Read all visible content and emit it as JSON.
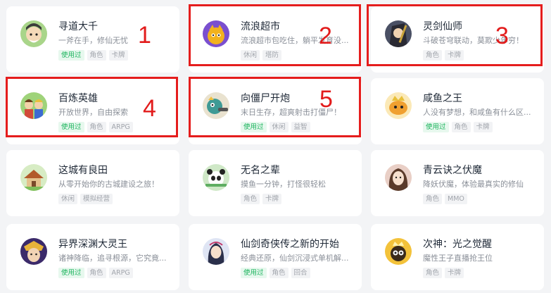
{
  "games": [
    {
      "title": "寻道大千",
      "desc": "一斧在手，修仙无忧",
      "tags": [
        "使用过",
        "角色",
        "卡牌"
      ],
      "avatar_icon": "cartoon-cultivator-icon",
      "avatar_color": "#8ac06a"
    },
    {
      "title": "流浪超市",
      "desc": "流浪超市包吃住，躺平发育没...",
      "tags": [
        "休闲",
        "塔防"
      ],
      "avatar_icon": "cartoon-kid-icon",
      "avatar_color": "#7a4fcf"
    },
    {
      "title": "灵剑仙师",
      "desc": "斗破苍穹联动，莫欺少年穷！",
      "tags": [
        "角色",
        "卡牌"
      ],
      "avatar_icon": "swordsman-icon",
      "avatar_color": "#3a3f4e"
    },
    {
      "title": "百炼英雄",
      "desc": "开放世界，自由探索",
      "tags": [
        "使用过",
        "角色",
        "ARPG"
      ],
      "avatar_icon": "hero-team-icon",
      "avatar_color": "#d24a3a"
    },
    {
      "title": "向僵尸开炮",
      "desc": "末日生存，超爽射击打僵尸！",
      "tags": [
        "使用过",
        "休闲",
        "益智"
      ],
      "avatar_icon": "zombie-gunner-icon",
      "avatar_color": "#2f8a86"
    },
    {
      "title": "咸鱼之王",
      "desc": "人没有梦想，和咸鱼有什么区...",
      "tags": [
        "使用过",
        "角色",
        "卡牌"
      ],
      "avatar_icon": "salted-fish-king-icon",
      "avatar_color": "#f0a030"
    },
    {
      "title": "这城有良田",
      "desc": "从零开始你的古城建设之旅！",
      "tags": [
        "休闲",
        "模拟经营"
      ],
      "avatar_icon": "village-building-icon",
      "avatar_color": "#c98a4a"
    },
    {
      "title": "无名之辈",
      "desc": "摸鱼一分钟，打怪很轻松",
      "tags": [
        "角色",
        "卡牌"
      ],
      "avatar_icon": "panda-icon",
      "avatar_color": "#5fae62"
    },
    {
      "title": "青云诀之伏魔",
      "desc": "降妖伏魔，体验最真实的修仙",
      "tags": [
        "角色",
        "MMO"
      ],
      "avatar_icon": "fairy-lady-icon",
      "avatar_color": "#d9a7a0"
    },
    {
      "title": "异界深渊大灵王",
      "desc": "诸神降临，追寻根源，它究竟...",
      "tags": [
        "使用过",
        "角色",
        "ARPG"
      ],
      "avatar_icon": "abyss-king-icon",
      "avatar_color": "#3b2a6a"
    },
    {
      "title": "仙剑奇侠传之新的开始",
      "desc": "经典还原，仙剑沉浸式单机解...",
      "tags": [
        "使用过",
        "角色",
        "回合"
      ],
      "avatar_icon": "sword-fairy-icon",
      "avatar_color": "#6a7fb8"
    },
    {
      "title": "次神：光之觉醒",
      "desc": "魔性王子直播抢王位",
      "tags": [
        "角色",
        "卡牌"
      ],
      "avatar_icon": "cartoon-prince-icon",
      "avatar_color": "#f3c23a"
    }
  ],
  "highlight_labels": [
    "1",
    "2",
    "3",
    "4",
    "5"
  ]
}
